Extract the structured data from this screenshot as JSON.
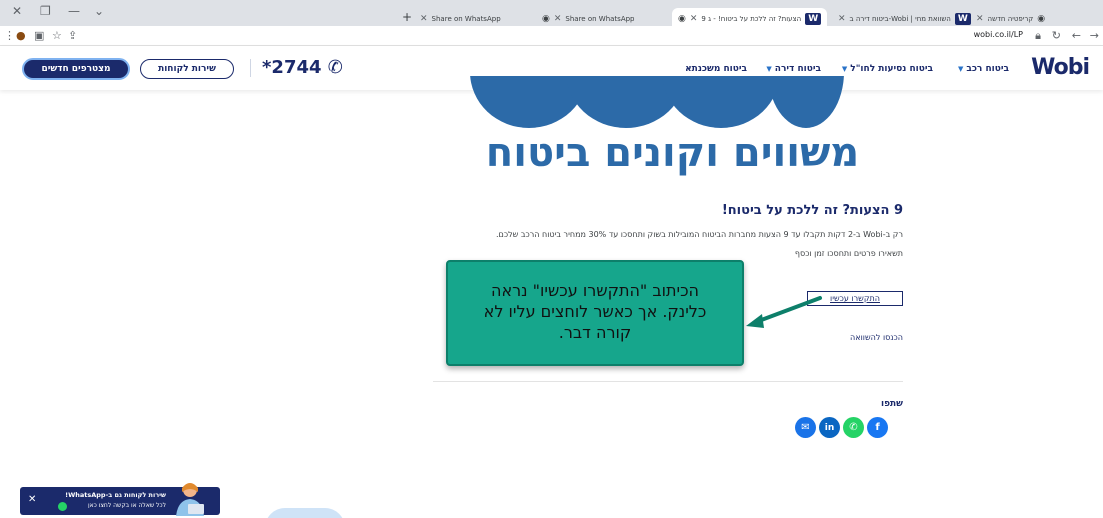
{
  "browser": {
    "tabs": [
      {
        "label": "9 הצעות? זה ללכת על ביטוח! - ג"
      },
      {
        "label": "ביטוח דירה ב-Wobi | השוואת מחי"
      },
      {
        "label": "קריפטיה חדשה"
      },
      {
        "label": "Share on WhatsApp"
      },
      {
        "label": "Share on WhatsApp"
      }
    ],
    "url": "wobi.co.il/LP"
  },
  "header": {
    "logo": "Wobi",
    "menu": [
      "ביטוח רכב",
      "ביטוח נסיעות לחו\"ל",
      "ביטוח דירה",
      "ביטוח משכנתא"
    ],
    "phone": "*2744",
    "customer_service": "שירות לקוחות",
    "new_customers": "מצטרפים חדשים"
  },
  "hero": {
    "text": "משווים וקונים ביטוח"
  },
  "article": {
    "title": "9 הצעות? זה ללכת על ביטוח!",
    "paragraph1": "רק ב-Wobi ב-2 דקות תקבלו עד 9 הצעות מחברות הביטוח המובילות בשוק ותחסכו עד 30% ממחיר ביטוח הרכב שלכם.",
    "paragraph2": "תשאירו פרטים ותחסכו זמן וכסף",
    "call_now": "התקשרו עכשיו",
    "compare": "הכנסו להשוואה",
    "share_label": "שתפו"
  },
  "callout": {
    "text": "הכיתוב \"התקשרו עכשיו\" נראה כלינק. אך כאשר לוחצים עליו לא קורה דבר."
  },
  "whatsapp_banner": {
    "line1": "שירות לקוחות גם ב-WhatsApp!",
    "line2": "לכל שאלה או בקשה לחצו כאן"
  },
  "colors": {
    "brand_navy": "#1b2a6b",
    "hero_blue": "#2c6aa8",
    "callout_green": "#16a68c",
    "whatsapp": "#25d366",
    "facebook": "#1877f2",
    "linkedin": "#0a66c2",
    "email": "#1a73e8"
  },
  "icons": [
    "close-icon",
    "minimize-icon",
    "restore-icon",
    "lock-icon",
    "back-icon",
    "reload-icon",
    "star-icon",
    "facebook-icon",
    "whatsapp-icon",
    "linkedin-icon",
    "email-icon",
    "phone-icon"
  ]
}
